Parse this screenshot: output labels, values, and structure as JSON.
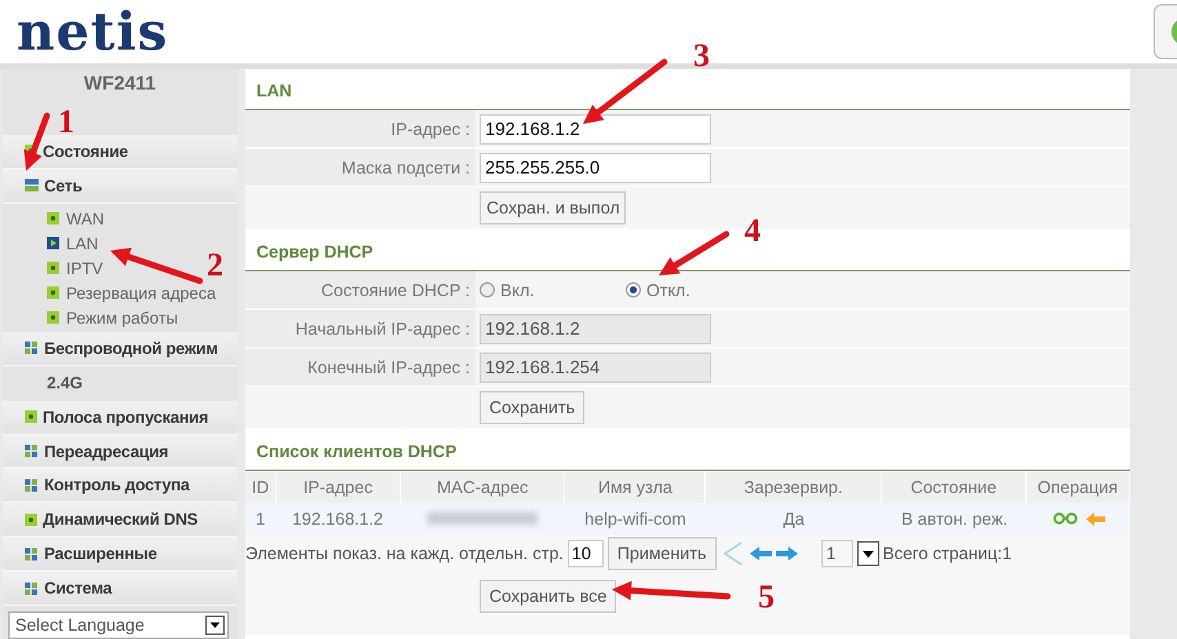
{
  "header": {
    "logo": "netis"
  },
  "sidebar": {
    "model": "WF2411",
    "items": [
      {
        "label": "Состояние",
        "kind": "page"
      },
      {
        "label": "Сеть",
        "kind": "group",
        "expanded": true,
        "children": [
          {
            "label": "WAN",
            "selected": false
          },
          {
            "label": "LAN",
            "selected": true
          },
          {
            "label": "IPTV",
            "selected": false
          },
          {
            "label": "Резервация адреса",
            "selected": false
          },
          {
            "label": "Режим работы",
            "selected": false
          }
        ]
      },
      {
        "label": "Беспроводной режим",
        "kind": "group",
        "expanded": false,
        "children": [
          {
            "label": "2.4G",
            "kind": "plain"
          }
        ]
      },
      {
        "label": "Полоса пропускания",
        "kind": "page"
      },
      {
        "label": "Переадресация",
        "kind": "group",
        "expanded": false
      },
      {
        "label": "Контроль доступа",
        "kind": "group",
        "expanded": false
      },
      {
        "label": "Динамический DNS",
        "kind": "page"
      },
      {
        "label": "Расширенные",
        "kind": "group",
        "expanded": false
      },
      {
        "label": "Система",
        "kind": "group",
        "expanded": false
      }
    ],
    "language": {
      "value": "Select Language"
    }
  },
  "lan": {
    "title": "LAN",
    "fields": [
      {
        "label": "IP-адрес :",
        "value": "192.168.1.2",
        "disabled": false
      },
      {
        "label": "Маска подсети :",
        "value": "255.255.255.0",
        "disabled": false
      }
    ],
    "button": "Сохран. и выпол"
  },
  "dhcp": {
    "title": "Сервер DHCP",
    "state_label": "Состояние DHCP :",
    "options": [
      {
        "label": "Вкл.",
        "selected": false
      },
      {
        "label": "Откл.",
        "selected": true
      }
    ],
    "fields": [
      {
        "label": "Начальный IP-адрес :",
        "value": "192.168.1.2",
        "disabled": true
      },
      {
        "label": "Конечный IP-адрес :",
        "value": "192.168.1.254",
        "disabled": true
      }
    ],
    "button": "Сохранить"
  },
  "clients": {
    "title": "Список клиентов DHCP",
    "columns": [
      "ID",
      "IP-адрес",
      "MAC-адрес",
      "Имя узла",
      "Зарезервир.",
      "Состояние",
      "Операция"
    ],
    "rows": [
      {
        "id": "1",
        "ip": "192.168.1.2",
        "name": "help-wifi-com",
        "reserved": "Да",
        "state": "В автон. реж."
      }
    ],
    "per_page_label": "Элементы показ. на кажд. отдельн. стр.",
    "per_page": "10",
    "apply": "Применить",
    "page": "1",
    "total": "Всего страниц:1",
    "save_all": "Сохранить все"
  },
  "annotations": [
    {
      "number": "1"
    },
    {
      "number": "2"
    },
    {
      "number": "3"
    },
    {
      "number": "4"
    },
    {
      "number": "5"
    }
  ]
}
